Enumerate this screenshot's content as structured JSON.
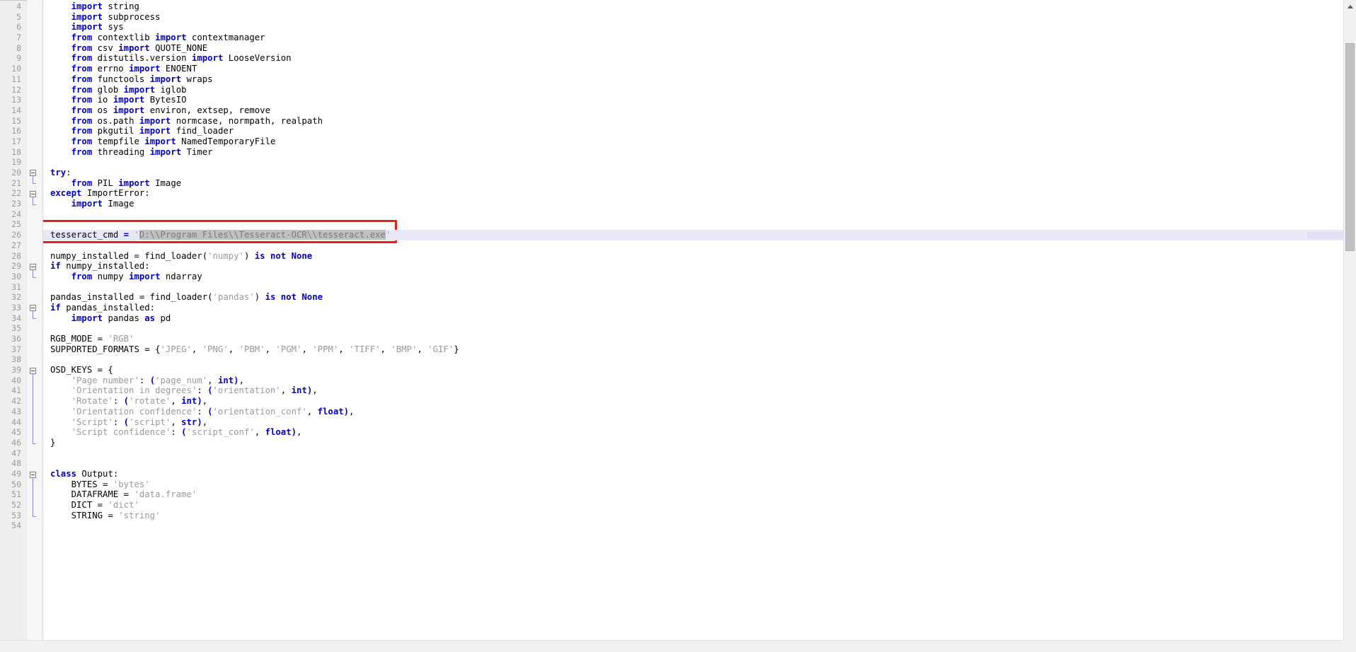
{
  "editor": {
    "first_line": 4,
    "last_line": 54,
    "current_line": 26,
    "language": "python",
    "colors": {
      "keyword": "#0000c8",
      "string": "#9a9a9a",
      "text": "#000000",
      "gutter_bg": "#efefef",
      "linenumber": "#9a9a9a",
      "current_line_bg": "#e8e8f8",
      "selection_bg": "#c0c0c0",
      "annotation_box": "#e8201a"
    }
  },
  "annotation": {
    "type": "red-rectangle",
    "target_line": 26,
    "note": "highlights tesseract_cmd path assignment"
  },
  "scrollbar": {
    "vertical_up_arrow": "▲",
    "vertical_down_arrow": "▼",
    "thumb_top_pct": 5,
    "thumb_height_pct": 33
  },
  "lines": [
    {
      "n": 4,
      "fold": "none",
      "tokens": [
        {
          "t": "    ",
          "c": "pl"
        },
        {
          "t": "import",
          "c": "kw"
        },
        {
          "t": " string",
          "c": "pl"
        }
      ]
    },
    {
      "n": 5,
      "fold": "none",
      "tokens": [
        {
          "t": "    ",
          "c": "pl"
        },
        {
          "t": "import",
          "c": "kw"
        },
        {
          "t": " subprocess",
          "c": "pl"
        }
      ]
    },
    {
      "n": 6,
      "fold": "none",
      "tokens": [
        {
          "t": "    ",
          "c": "pl"
        },
        {
          "t": "import",
          "c": "kw"
        },
        {
          "t": " sys",
          "c": "pl"
        }
      ]
    },
    {
      "n": 7,
      "fold": "none",
      "tokens": [
        {
          "t": "    ",
          "c": "pl"
        },
        {
          "t": "from",
          "c": "kw"
        },
        {
          "t": " contextlib ",
          "c": "pl"
        },
        {
          "t": "import",
          "c": "kw"
        },
        {
          "t": " contextmanager",
          "c": "pl"
        }
      ]
    },
    {
      "n": 8,
      "fold": "none",
      "tokens": [
        {
          "t": "    ",
          "c": "pl"
        },
        {
          "t": "from",
          "c": "kw"
        },
        {
          "t": " csv ",
          "c": "pl"
        },
        {
          "t": "import",
          "c": "kw"
        },
        {
          "t": " QUOTE_NONE",
          "c": "pl"
        }
      ]
    },
    {
      "n": 9,
      "fold": "none",
      "tokens": [
        {
          "t": "    ",
          "c": "pl"
        },
        {
          "t": "from",
          "c": "kw"
        },
        {
          "t": " distutils.version ",
          "c": "pl"
        },
        {
          "t": "import",
          "c": "kw"
        },
        {
          "t": " LooseVersion",
          "c": "pl"
        }
      ]
    },
    {
      "n": 10,
      "fold": "none",
      "tokens": [
        {
          "t": "    ",
          "c": "pl"
        },
        {
          "t": "from",
          "c": "kw"
        },
        {
          "t": " errno ",
          "c": "pl"
        },
        {
          "t": "import",
          "c": "kw"
        },
        {
          "t": " ENOENT",
          "c": "pl"
        }
      ]
    },
    {
      "n": 11,
      "fold": "none",
      "tokens": [
        {
          "t": "    ",
          "c": "pl"
        },
        {
          "t": "from",
          "c": "kw"
        },
        {
          "t": " functools ",
          "c": "pl"
        },
        {
          "t": "import",
          "c": "kw"
        },
        {
          "t": " wraps",
          "c": "pl"
        }
      ]
    },
    {
      "n": 12,
      "fold": "none",
      "tokens": [
        {
          "t": "    ",
          "c": "pl"
        },
        {
          "t": "from",
          "c": "kw"
        },
        {
          "t": " glob ",
          "c": "pl"
        },
        {
          "t": "import",
          "c": "kw"
        },
        {
          "t": " iglob",
          "c": "pl"
        }
      ]
    },
    {
      "n": 13,
      "fold": "none",
      "tokens": [
        {
          "t": "    ",
          "c": "pl"
        },
        {
          "t": "from",
          "c": "kw"
        },
        {
          "t": " io ",
          "c": "pl"
        },
        {
          "t": "import",
          "c": "kw"
        },
        {
          "t": " BytesIO",
          "c": "pl"
        }
      ]
    },
    {
      "n": 14,
      "fold": "none",
      "tokens": [
        {
          "t": "    ",
          "c": "pl"
        },
        {
          "t": "from",
          "c": "kw"
        },
        {
          "t": " os ",
          "c": "pl"
        },
        {
          "t": "import",
          "c": "kw"
        },
        {
          "t": " environ, extsep, remove",
          "c": "pl"
        }
      ]
    },
    {
      "n": 15,
      "fold": "none",
      "tokens": [
        {
          "t": "    ",
          "c": "pl"
        },
        {
          "t": "from",
          "c": "kw"
        },
        {
          "t": " os.path ",
          "c": "pl"
        },
        {
          "t": "import",
          "c": "kw"
        },
        {
          "t": " normcase, normpath, realpath",
          "c": "pl"
        }
      ]
    },
    {
      "n": 16,
      "fold": "none",
      "tokens": [
        {
          "t": "    ",
          "c": "pl"
        },
        {
          "t": "from",
          "c": "kw"
        },
        {
          "t": " pkgutil ",
          "c": "pl"
        },
        {
          "t": "import",
          "c": "kw"
        },
        {
          "t": " find_loader",
          "c": "pl"
        }
      ]
    },
    {
      "n": 17,
      "fold": "none",
      "tokens": [
        {
          "t": "    ",
          "c": "pl"
        },
        {
          "t": "from",
          "c": "kw"
        },
        {
          "t": " tempfile ",
          "c": "pl"
        },
        {
          "t": "import",
          "c": "kw"
        },
        {
          "t": " NamedTemporaryFile",
          "c": "pl"
        }
      ]
    },
    {
      "n": 18,
      "fold": "none",
      "tokens": [
        {
          "t": "    ",
          "c": "pl"
        },
        {
          "t": "from",
          "c": "kw"
        },
        {
          "t": " threading ",
          "c": "pl"
        },
        {
          "t": "import",
          "c": "kw"
        },
        {
          "t": " Timer",
          "c": "pl"
        }
      ]
    },
    {
      "n": 19,
      "fold": "none",
      "tokens": []
    },
    {
      "n": 20,
      "fold": "open",
      "tokens": [
        {
          "t": "try",
          "c": "kw"
        },
        {
          "t": ":",
          "c": "pl"
        }
      ]
    },
    {
      "n": 21,
      "fold": "mid",
      "tokens": [
        {
          "t": "    ",
          "c": "pl"
        },
        {
          "t": "from",
          "c": "kw"
        },
        {
          "t": " PIL ",
          "c": "pl"
        },
        {
          "t": "import",
          "c": "kw"
        },
        {
          "t": " Image",
          "c": "pl"
        }
      ]
    },
    {
      "n": 22,
      "fold": "open",
      "tokens": [
        {
          "t": "except",
          "c": "kw"
        },
        {
          "t": " ImportError:",
          "c": "pl"
        }
      ]
    },
    {
      "n": 23,
      "fold": "mid",
      "tokens": [
        {
          "t": "    ",
          "c": "pl"
        },
        {
          "t": "import",
          "c": "kw"
        },
        {
          "t": " Image",
          "c": "pl"
        }
      ]
    },
    {
      "n": 24,
      "fold": "none",
      "tokens": []
    },
    {
      "n": 25,
      "fold": "none",
      "tokens": []
    },
    {
      "n": 26,
      "fold": "none",
      "current": true,
      "tokens": [
        {
          "t": "tesseract_cmd ",
          "c": "pl"
        },
        {
          "t": "=",
          "c": "op"
        },
        {
          "t": " ",
          "c": "pl"
        },
        {
          "t": "'",
          "c": "str"
        },
        {
          "t": "D:\\\\Program Files\\\\Tesseract-OCR\\\\tesseract.exe",
          "c": "sel"
        },
        {
          "t": "'",
          "c": "str"
        }
      ]
    },
    {
      "n": 27,
      "fold": "none",
      "tokens": []
    },
    {
      "n": 28,
      "fold": "none",
      "tokens": [
        {
          "t": "numpy_installed = find_loader(",
          "c": "pl"
        },
        {
          "t": "'numpy'",
          "c": "str"
        },
        {
          "t": ") ",
          "c": "pl"
        },
        {
          "t": "is",
          "c": "kw"
        },
        {
          "t": " ",
          "c": "pl"
        },
        {
          "t": "not",
          "c": "kw"
        },
        {
          "t": " ",
          "c": "pl"
        },
        {
          "t": "None",
          "c": "kw"
        }
      ]
    },
    {
      "n": 29,
      "fold": "open",
      "tokens": [
        {
          "t": "if",
          "c": "kw"
        },
        {
          "t": " numpy_installed:",
          "c": "pl"
        }
      ]
    },
    {
      "n": 30,
      "fold": "mid",
      "tokens": [
        {
          "t": "    ",
          "c": "pl"
        },
        {
          "t": "from",
          "c": "kw"
        },
        {
          "t": " numpy ",
          "c": "pl"
        },
        {
          "t": "import",
          "c": "kw"
        },
        {
          "t": " ndarray",
          "c": "pl"
        }
      ]
    },
    {
      "n": 31,
      "fold": "none",
      "tokens": []
    },
    {
      "n": 32,
      "fold": "none",
      "tokens": [
        {
          "t": "pandas_installed = find_loader(",
          "c": "pl"
        },
        {
          "t": "'pandas'",
          "c": "str"
        },
        {
          "t": ") ",
          "c": "pl"
        },
        {
          "t": "is",
          "c": "kw"
        },
        {
          "t": " ",
          "c": "pl"
        },
        {
          "t": "not",
          "c": "kw"
        },
        {
          "t": " ",
          "c": "pl"
        },
        {
          "t": "None",
          "c": "kw"
        }
      ]
    },
    {
      "n": 33,
      "fold": "open",
      "tokens": [
        {
          "t": "if",
          "c": "kw"
        },
        {
          "t": " pandas_installed:",
          "c": "pl"
        }
      ]
    },
    {
      "n": 34,
      "fold": "mid",
      "tokens": [
        {
          "t": "    ",
          "c": "pl"
        },
        {
          "t": "import",
          "c": "kw"
        },
        {
          "t": " pandas ",
          "c": "pl"
        },
        {
          "t": "as",
          "c": "kw"
        },
        {
          "t": " pd",
          "c": "pl"
        }
      ]
    },
    {
      "n": 35,
      "fold": "none",
      "tokens": []
    },
    {
      "n": 36,
      "fold": "none",
      "tokens": [
        {
          "t": "RGB_MODE = ",
          "c": "pl"
        },
        {
          "t": "'RGB'",
          "c": "str"
        }
      ]
    },
    {
      "n": 37,
      "fold": "none",
      "tokens": [
        {
          "t": "SUPPORTED_FORMATS = {",
          "c": "pl"
        },
        {
          "t": "'JPEG'",
          "c": "str"
        },
        {
          "t": ", ",
          "c": "pl"
        },
        {
          "t": "'PNG'",
          "c": "str"
        },
        {
          "t": ", ",
          "c": "pl"
        },
        {
          "t": "'PBM'",
          "c": "str"
        },
        {
          "t": ", ",
          "c": "pl"
        },
        {
          "t": "'PGM'",
          "c": "str"
        },
        {
          "t": ", ",
          "c": "pl"
        },
        {
          "t": "'PPM'",
          "c": "str"
        },
        {
          "t": ", ",
          "c": "pl"
        },
        {
          "t": "'TIFF'",
          "c": "str"
        },
        {
          "t": ", ",
          "c": "pl"
        },
        {
          "t": "'BMP'",
          "c": "str"
        },
        {
          "t": ", ",
          "c": "pl"
        },
        {
          "t": "'GIF'",
          "c": "str"
        },
        {
          "t": "}",
          "c": "pl"
        }
      ]
    },
    {
      "n": 38,
      "fold": "none",
      "tokens": []
    },
    {
      "n": 39,
      "fold": "open",
      "tokens": [
        {
          "t": "OSD_KEYS = {",
          "c": "pl"
        }
      ]
    },
    {
      "n": 40,
      "fold": "bar",
      "tokens": [
        {
          "t": "    ",
          "c": "pl"
        },
        {
          "t": "'Page number'",
          "c": "str"
        },
        {
          "t": ": ",
          "c": "pl"
        },
        {
          "t": "(",
          "c": "op"
        },
        {
          "t": "'page_num'",
          "c": "str"
        },
        {
          "t": ", ",
          "c": "pl"
        },
        {
          "t": "int",
          "c": "kw"
        },
        {
          "t": ")",
          "c": "op"
        },
        {
          "t": ",",
          "c": "pl"
        }
      ]
    },
    {
      "n": 41,
      "fold": "bar",
      "tokens": [
        {
          "t": "    ",
          "c": "pl"
        },
        {
          "t": "'Orientation in degrees'",
          "c": "str"
        },
        {
          "t": ": ",
          "c": "pl"
        },
        {
          "t": "(",
          "c": "op"
        },
        {
          "t": "'orientation'",
          "c": "str"
        },
        {
          "t": ", ",
          "c": "pl"
        },
        {
          "t": "int",
          "c": "kw"
        },
        {
          "t": ")",
          "c": "op"
        },
        {
          "t": ",",
          "c": "pl"
        }
      ]
    },
    {
      "n": 42,
      "fold": "bar",
      "tokens": [
        {
          "t": "    ",
          "c": "pl"
        },
        {
          "t": "'Rotate'",
          "c": "str"
        },
        {
          "t": ": ",
          "c": "pl"
        },
        {
          "t": "(",
          "c": "op"
        },
        {
          "t": "'rotate'",
          "c": "str"
        },
        {
          "t": ", ",
          "c": "pl"
        },
        {
          "t": "int",
          "c": "kw"
        },
        {
          "t": ")",
          "c": "op"
        },
        {
          "t": ",",
          "c": "pl"
        }
      ]
    },
    {
      "n": 43,
      "fold": "bar",
      "tokens": [
        {
          "t": "    ",
          "c": "pl"
        },
        {
          "t": "'Orientation confidence'",
          "c": "str"
        },
        {
          "t": ": ",
          "c": "pl"
        },
        {
          "t": "(",
          "c": "op"
        },
        {
          "t": "'orientation_conf'",
          "c": "str"
        },
        {
          "t": ", ",
          "c": "pl"
        },
        {
          "t": "float",
          "c": "kw"
        },
        {
          "t": ")",
          "c": "op"
        },
        {
          "t": ",",
          "c": "pl"
        }
      ]
    },
    {
      "n": 44,
      "fold": "bar",
      "tokens": [
        {
          "t": "    ",
          "c": "pl"
        },
        {
          "t": "'Script'",
          "c": "str"
        },
        {
          "t": ": ",
          "c": "pl"
        },
        {
          "t": "(",
          "c": "op"
        },
        {
          "t": "'script'",
          "c": "str"
        },
        {
          "t": ", ",
          "c": "pl"
        },
        {
          "t": "str",
          "c": "kw"
        },
        {
          "t": ")",
          "c": "op"
        },
        {
          "t": ",",
          "c": "pl"
        }
      ]
    },
    {
      "n": 45,
      "fold": "bar",
      "tokens": [
        {
          "t": "    ",
          "c": "pl"
        },
        {
          "t": "'Script confidence'",
          "c": "str"
        },
        {
          "t": ": ",
          "c": "pl"
        },
        {
          "t": "(",
          "c": "op"
        },
        {
          "t": "'script_conf'",
          "c": "str"
        },
        {
          "t": ", ",
          "c": "pl"
        },
        {
          "t": "float",
          "c": "kw"
        },
        {
          "t": ")",
          "c": "op"
        },
        {
          "t": ",",
          "c": "pl"
        }
      ]
    },
    {
      "n": 46,
      "fold": "mid",
      "tokens": [
        {
          "t": "}",
          "c": "pl"
        }
      ]
    },
    {
      "n": 47,
      "fold": "none",
      "tokens": []
    },
    {
      "n": 48,
      "fold": "none",
      "tokens": []
    },
    {
      "n": 49,
      "fold": "open",
      "tokens": [
        {
          "t": "class",
          "c": "kw"
        },
        {
          "t": " Output:",
          "c": "pl"
        }
      ]
    },
    {
      "n": 50,
      "fold": "bar",
      "tokens": [
        {
          "t": "    ",
          "c": "pl"
        },
        {
          "t": "BYTES = ",
          "c": "pl"
        },
        {
          "t": "'bytes'",
          "c": "str"
        }
      ]
    },
    {
      "n": 51,
      "fold": "bar",
      "tokens": [
        {
          "t": "    ",
          "c": "pl"
        },
        {
          "t": "DATAFRAME = ",
          "c": "pl"
        },
        {
          "t": "'data.frame'",
          "c": "str"
        }
      ]
    },
    {
      "n": 52,
      "fold": "bar",
      "tokens": [
        {
          "t": "    ",
          "c": "pl"
        },
        {
          "t": "DICT = ",
          "c": "pl"
        },
        {
          "t": "'dict'",
          "c": "str"
        }
      ]
    },
    {
      "n": 53,
      "fold": "mid",
      "tokens": [
        {
          "t": "    ",
          "c": "pl"
        },
        {
          "t": "STRING = ",
          "c": "pl"
        },
        {
          "t": "'string'",
          "c": "str"
        }
      ]
    },
    {
      "n": 54,
      "fold": "none",
      "tokens": []
    }
  ]
}
